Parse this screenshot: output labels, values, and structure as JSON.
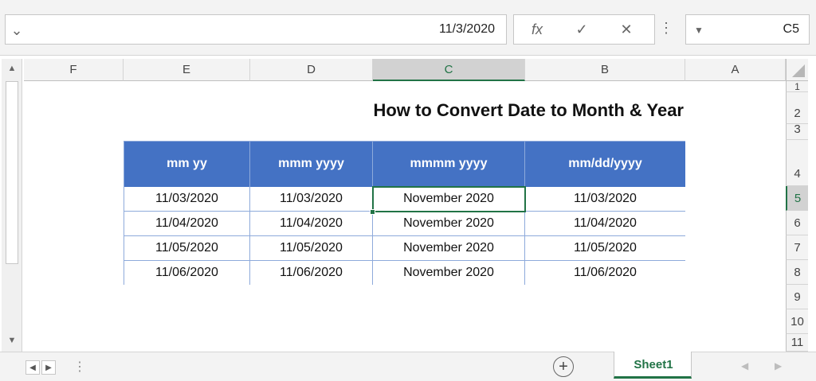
{
  "formula_bar": {
    "name_box": "C5",
    "formula_value": "11/3/2020",
    "fx_label": "fx",
    "cancel_symbol": "✕",
    "enter_symbol": "✓",
    "expand_symbol": "⌄"
  },
  "columns": [
    "A",
    "B",
    "C",
    "D",
    "E",
    "F"
  ],
  "rows": [
    "1",
    "2",
    "3",
    "4",
    "5",
    "6",
    "7",
    "8",
    "9",
    "10",
    "11"
  ],
  "selected_cell": "C5",
  "sheet": {
    "title": "How to Convert Date to Month & Year",
    "headers": [
      "mm/dd/yyyy",
      "mmmm yyyy",
      "mmm yyyy",
      "mm yy"
    ],
    "rows": [
      [
        "11/03/2020",
        "November 2020",
        "11/03/2020",
        "11/03/2020"
      ],
      [
        "11/04/2020",
        "November 2020",
        "11/04/2020",
        "11/04/2020"
      ],
      [
        "11/05/2020",
        "November 2020",
        "11/05/2020",
        "11/05/2020"
      ],
      [
        "11/06/2020",
        "November 2020",
        "11/06/2020",
        "11/06/2020"
      ]
    ]
  },
  "tabs": {
    "active": "Sheet1",
    "add_symbol": "+"
  },
  "colors": {
    "header_fill": "#4472c4",
    "accent": "#217346",
    "border": "#8eaadb"
  }
}
